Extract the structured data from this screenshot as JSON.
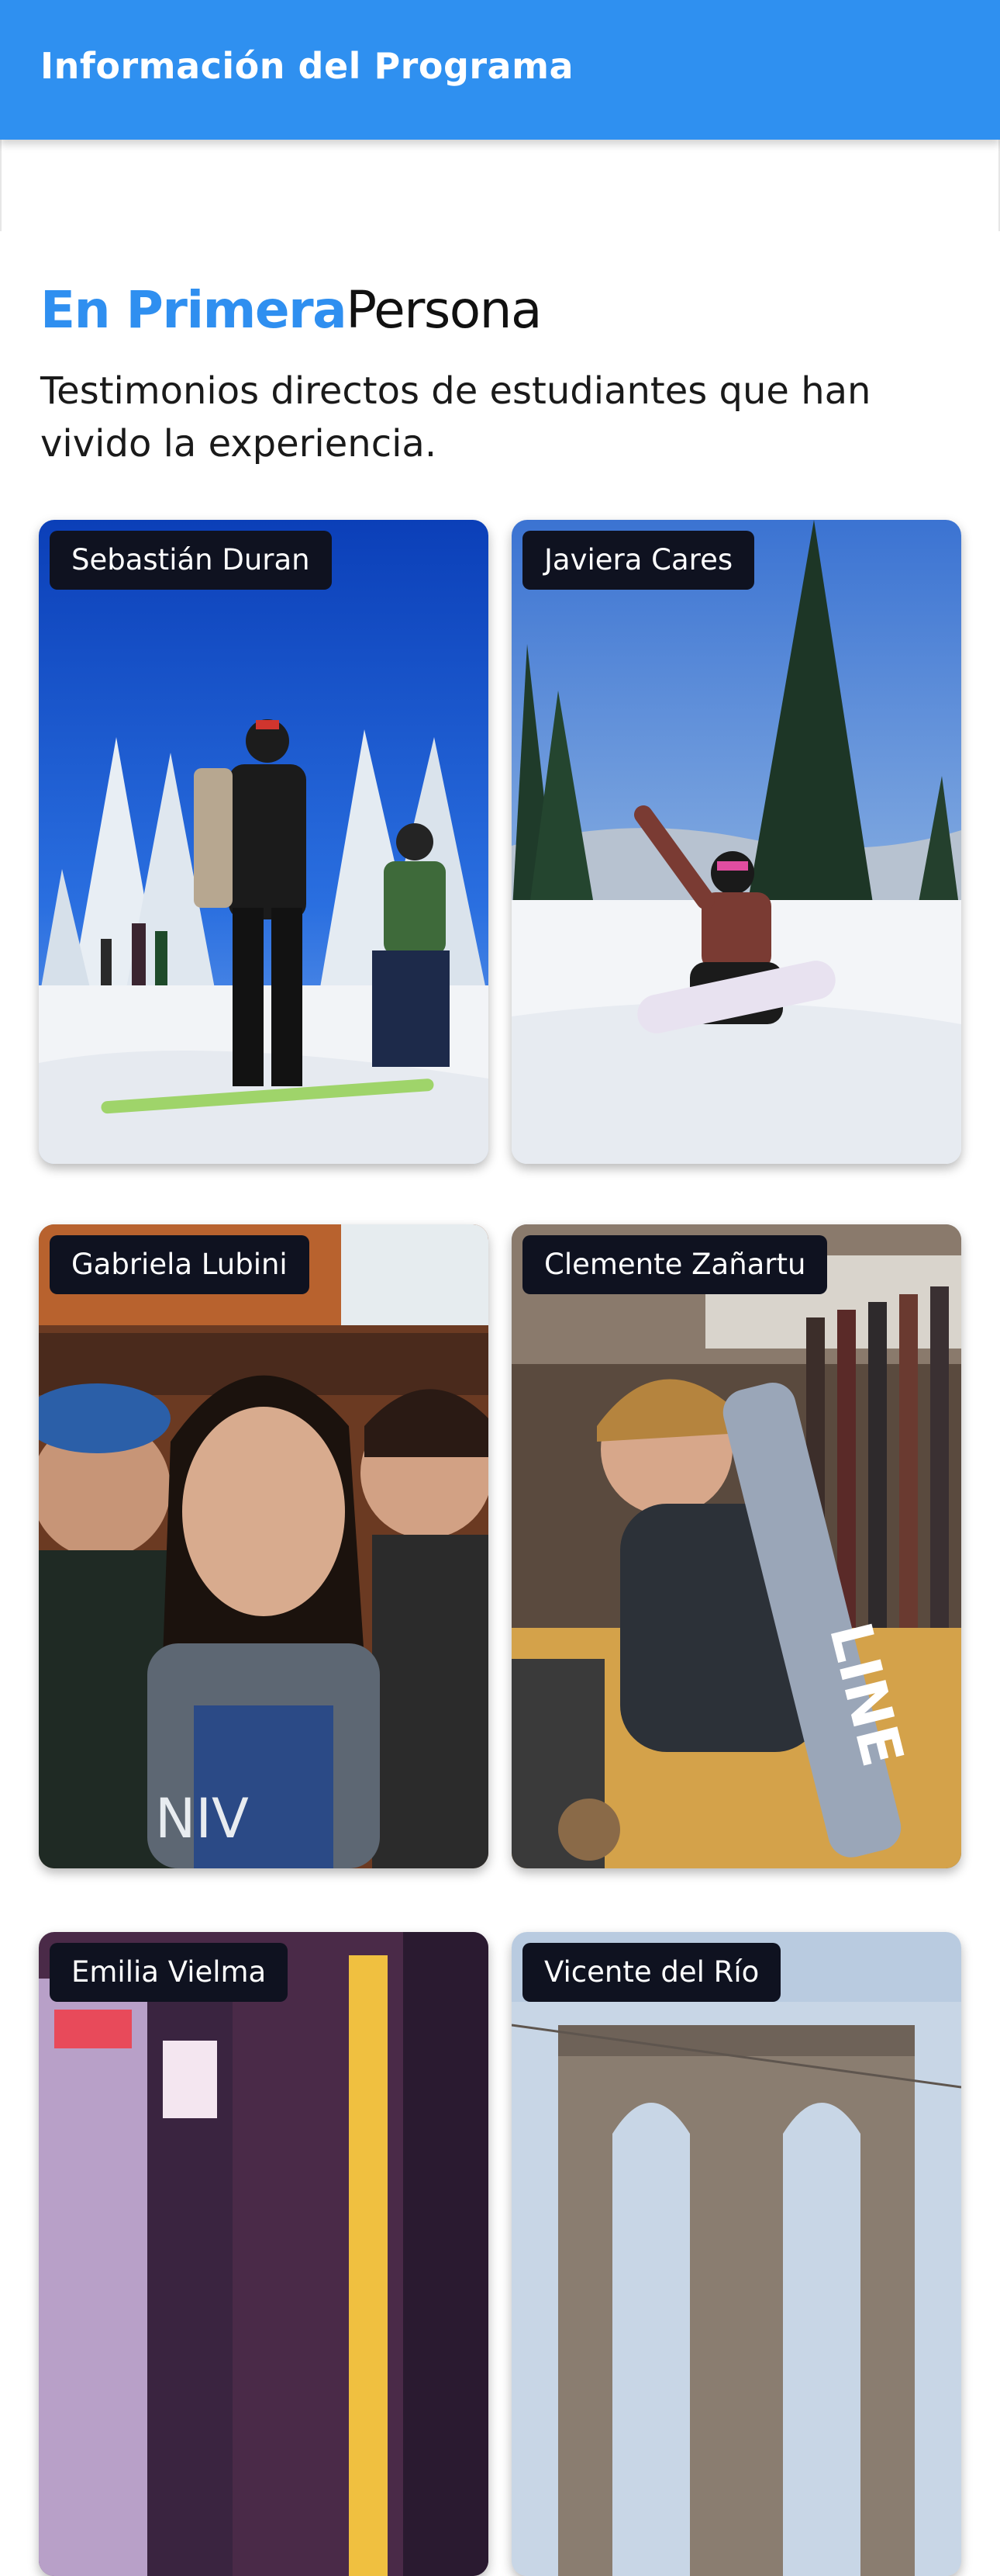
{
  "appbar": {
    "title": "Información del Programa"
  },
  "section": {
    "heading_accent": "En Primera",
    "heading_plain": "Persona",
    "subtitle": "Testimonios directos de estudiantes que han vivido la experiencia."
  },
  "testimonials": [
    {
      "name": "Sebastián Duran",
      "photo": "snowboarders on ski slope"
    },
    {
      "name": "Javiera Cares",
      "photo": "snowboarder kneeling in snow"
    },
    {
      "name": "Gabriela Lubini",
      "photo": "group selfie indoors"
    },
    {
      "name": "Clemente Zañartu",
      "photo": "waxing a LINE ski in workshop"
    },
    {
      "name": "Emilia Vielma",
      "photo": "city at night with billboards"
    },
    {
      "name": "Vicente del Río",
      "photo": "bridge tower"
    }
  ],
  "colors": {
    "primary": "#2f90f0",
    "tag_bg": "#0f1220"
  }
}
